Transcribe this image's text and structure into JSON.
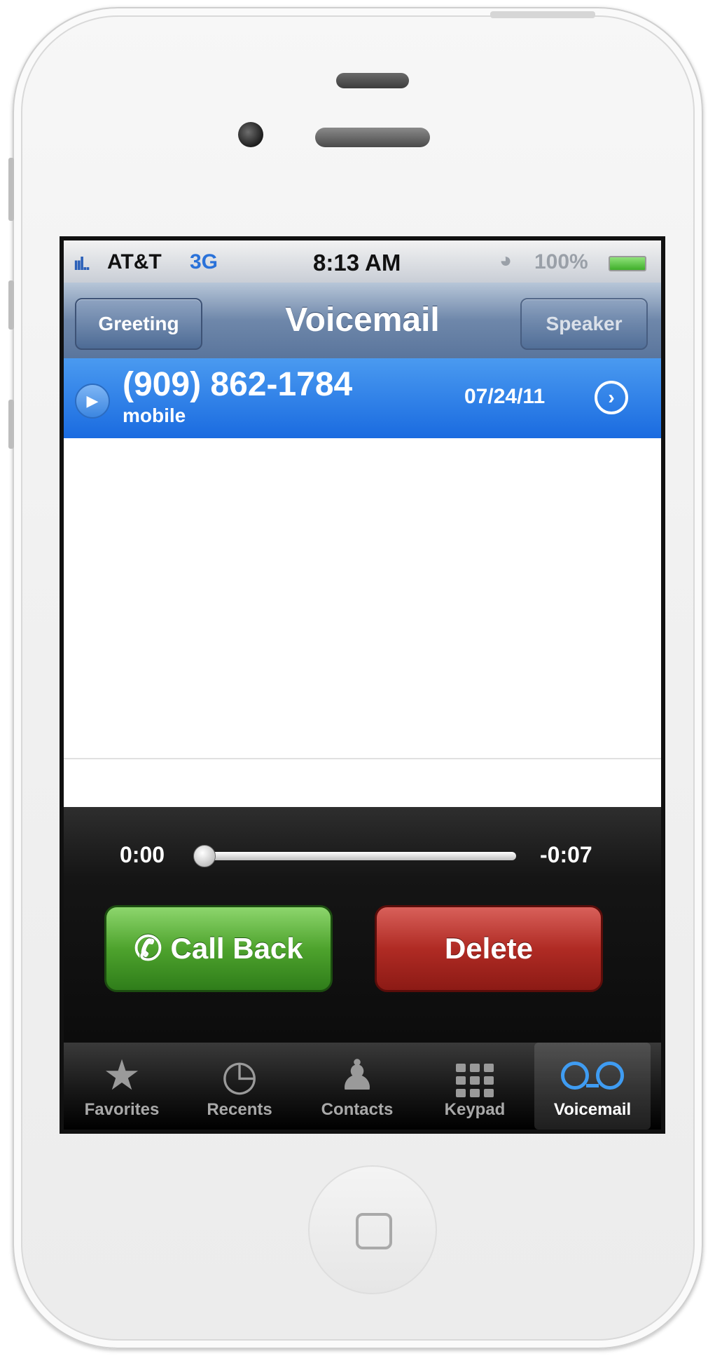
{
  "status_bar": {
    "signal": "ııl..",
    "carrier": "AT&T",
    "network": "3G",
    "time": "8:13 AM",
    "battery": "100%"
  },
  "nav": {
    "title": "Voicemail",
    "left_button": "Greeting",
    "right_button": "Speaker"
  },
  "selected_voicemail": {
    "caller": "(909) 862-1784",
    "label": "mobile",
    "date": "07/24/11"
  },
  "player": {
    "elapsed": "0:00",
    "remaining": "-0:07",
    "progress": 0.0,
    "call_back_label": "Call Back",
    "delete_label": "Delete"
  },
  "tabs": [
    {
      "label": "Favorites",
      "icon": "star-icon"
    },
    {
      "label": "Recents",
      "icon": "clock-icon"
    },
    {
      "label": "Contacts",
      "icon": "person-icon"
    },
    {
      "label": "Keypad",
      "icon": "keypad-icon"
    },
    {
      "label": "Voicemail",
      "icon": "voicemail-icon",
      "active": true
    }
  ],
  "colors": {
    "selected_row": "#1a6be0",
    "call_back": "#4ea32d",
    "delete": "#b02b24",
    "active_tab_icon": "#3f9cf2"
  }
}
